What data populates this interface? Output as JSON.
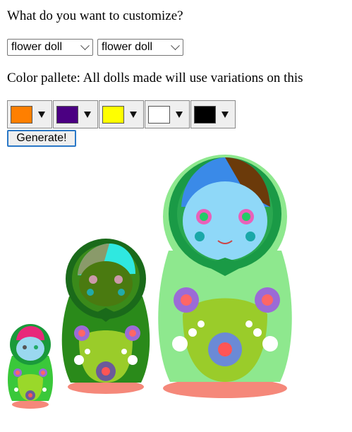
{
  "question": "What do you want to customize?",
  "selects": [
    {
      "value": "flower doll"
    },
    {
      "value": "flower doll"
    }
  ],
  "palette_label": "Color pallete: All dolls made will use variations on this",
  "palette": [
    {
      "color": "#ff7f00",
      "icon": "dropdown-triangle"
    },
    {
      "color": "#4b0082",
      "icon": "dropdown-triangle"
    },
    {
      "color": "#ffff00",
      "icon": "dropdown-triangle"
    },
    {
      "color": "#ffffff",
      "icon": "dropdown-triangle"
    },
    {
      "color": "#000000",
      "icon": "dropdown-triangle"
    }
  ],
  "generate_label": "Generate!"
}
